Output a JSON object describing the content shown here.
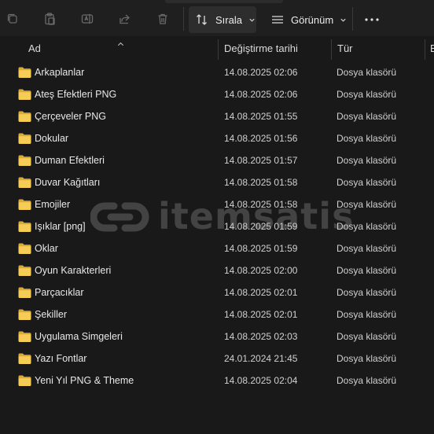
{
  "toolbar": {
    "icons": [
      "copy-icon",
      "paste-icon",
      "rename-icon",
      "share-icon",
      "delete-icon"
    ],
    "sort_label": "Sırala",
    "view_label": "Görünüm",
    "more_icon": "more-icon"
  },
  "columns": {
    "name": "Ad",
    "modified": "Değiştirme tarihi",
    "type": "Tür",
    "size": "B"
  },
  "files": [
    {
      "name": "Arkaplanlar",
      "date": "14.08.2025 02:06",
      "type": "Dosya klasörü"
    },
    {
      "name": "Ateş Efektleri PNG",
      "date": "14.08.2025 02:06",
      "type": "Dosya klasörü"
    },
    {
      "name": "Çerçeveler PNG",
      "date": "14.08.2025 01:55",
      "type": "Dosya klasörü"
    },
    {
      "name": "Dokular",
      "date": "14.08.2025 01:56",
      "type": "Dosya klasörü"
    },
    {
      "name": "Duman Efektleri",
      "date": "14.08.2025 01:57",
      "type": "Dosya klasörü"
    },
    {
      "name": "Duvar Kağıtları",
      "date": "14.08.2025 01:58",
      "type": "Dosya klasörü"
    },
    {
      "name": "Emojiler",
      "date": "14.08.2025 01:58",
      "type": "Dosya klasörü"
    },
    {
      "name": "Işıklar [png]",
      "date": "14.08.2025 01:59",
      "type": "Dosya klasörü"
    },
    {
      "name": "Oklar",
      "date": "14.08.2025 01:59",
      "type": "Dosya klasörü"
    },
    {
      "name": "Oyun Karakterleri",
      "date": "14.08.2025 02:00",
      "type": "Dosya klasörü"
    },
    {
      "name": "Parçacıklar",
      "date": "14.08.2025 02:01",
      "type": "Dosya klasörü"
    },
    {
      "name": "Şekiller",
      "date": "14.08.2025 02:01",
      "type": "Dosya klasörü"
    },
    {
      "name": "Uygulama Simgeleri",
      "date": "14.08.2025 02:03",
      "type": "Dosya klasörü"
    },
    {
      "name": "Yazı Fontlar",
      "date": "24.01.2024 21:45",
      "type": "Dosya klasörü"
    },
    {
      "name": "Yeni Yıl PNG & Theme",
      "date": "14.08.2025 02:04",
      "type": "Dosya klasörü"
    }
  ],
  "watermark": {
    "text": "itemsatis"
  },
  "colors": {
    "folder": "#f2c94c",
    "background": "#191919"
  }
}
